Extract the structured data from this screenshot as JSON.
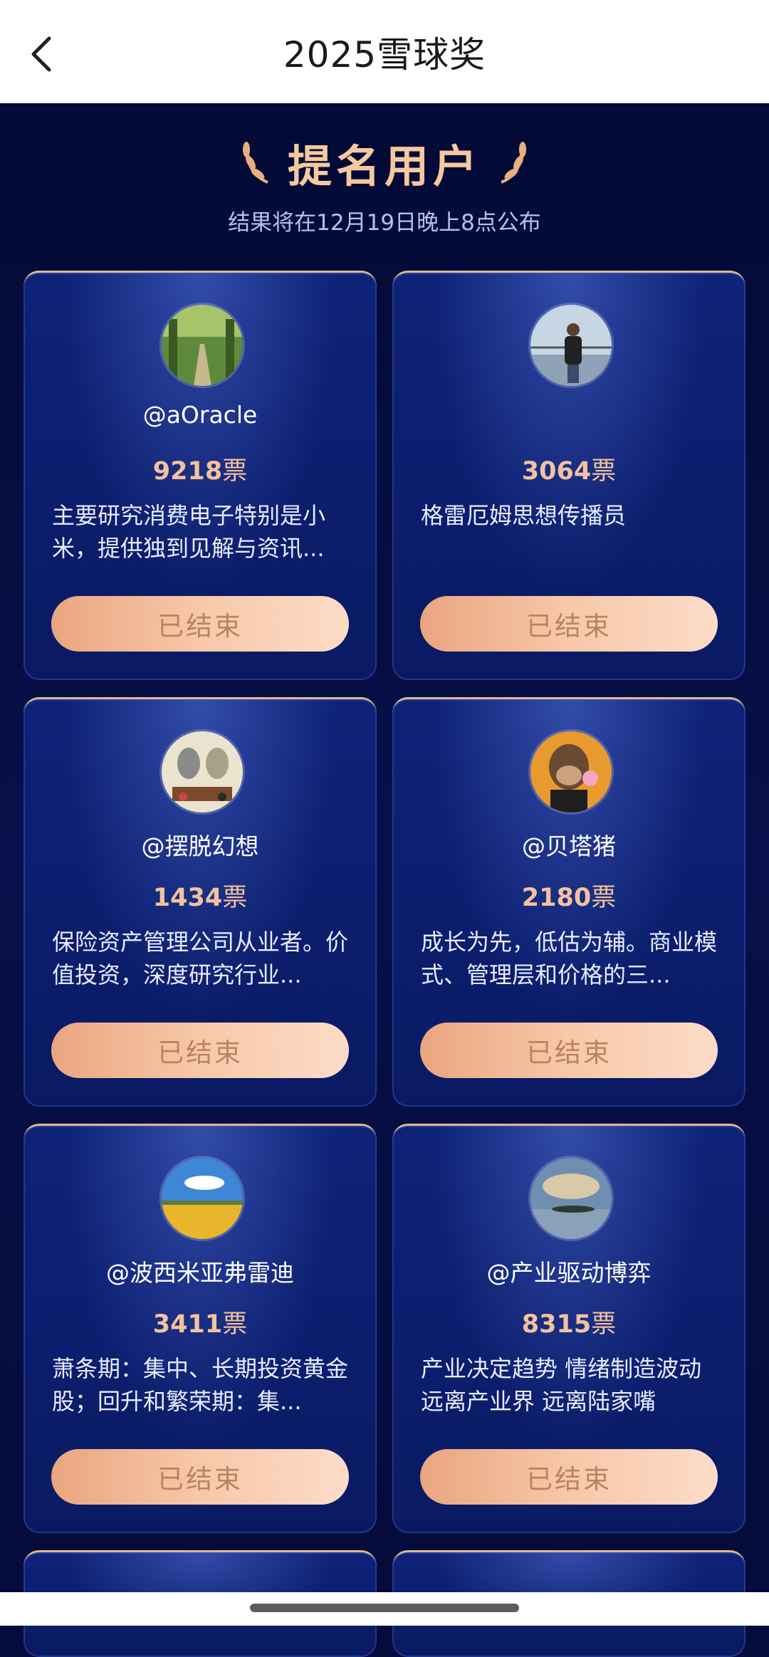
{
  "header": {
    "title": "2025雪球奖",
    "back_icon": "chevron-left-icon"
  },
  "hero": {
    "title": "提名用户",
    "subtitle": "结果将在12月19日晚上8点公布"
  },
  "colors": {
    "accent": "#f6c89f",
    "background": "#050b3a",
    "card": "#0e2278",
    "button": "#f7c8a9"
  },
  "cards": [
    {
      "username": "@aOracle",
      "votes": "9218",
      "unit": "票",
      "desc": "主要研究消费电子特别是小米，提供独到见解与资讯...",
      "button": "已结束",
      "avatar": "vineyard-path"
    },
    {
      "username": "",
      "votes": "3064",
      "unit": "票",
      "desc": "格雷厄姆思想传播员",
      "button": "已结束",
      "avatar": "person-on-bridge"
    },
    {
      "username": "@摆脱幻想",
      "votes": "1434",
      "unit": "票",
      "desc": "保险资产管理公司从业者。价值投资，深度研究行业...",
      "button": "已结束",
      "avatar": "cartoon-wolves"
    },
    {
      "username": "@贝塔猪",
      "votes": "2180",
      "unit": "票",
      "desc": "成长为先，低估为辅。商业模式、管理层和价格的三...",
      "button": "已结束",
      "avatar": "ape-bubblegum"
    },
    {
      "username": "@波西米亚弗雷迪",
      "votes": "3411",
      "unit": "票",
      "desc": "萧条期：集中、长期投资黄金股；回升和繁荣期：集...",
      "button": "已结束",
      "avatar": "wheat-field-sky"
    },
    {
      "username": "@产业驱动博弈",
      "votes": "8315",
      "unit": "票",
      "desc": "产业决定趋势 情绪制造波动 远离产业界 远离陆家嘴",
      "button": "已结束",
      "avatar": "lake-sunset"
    }
  ]
}
